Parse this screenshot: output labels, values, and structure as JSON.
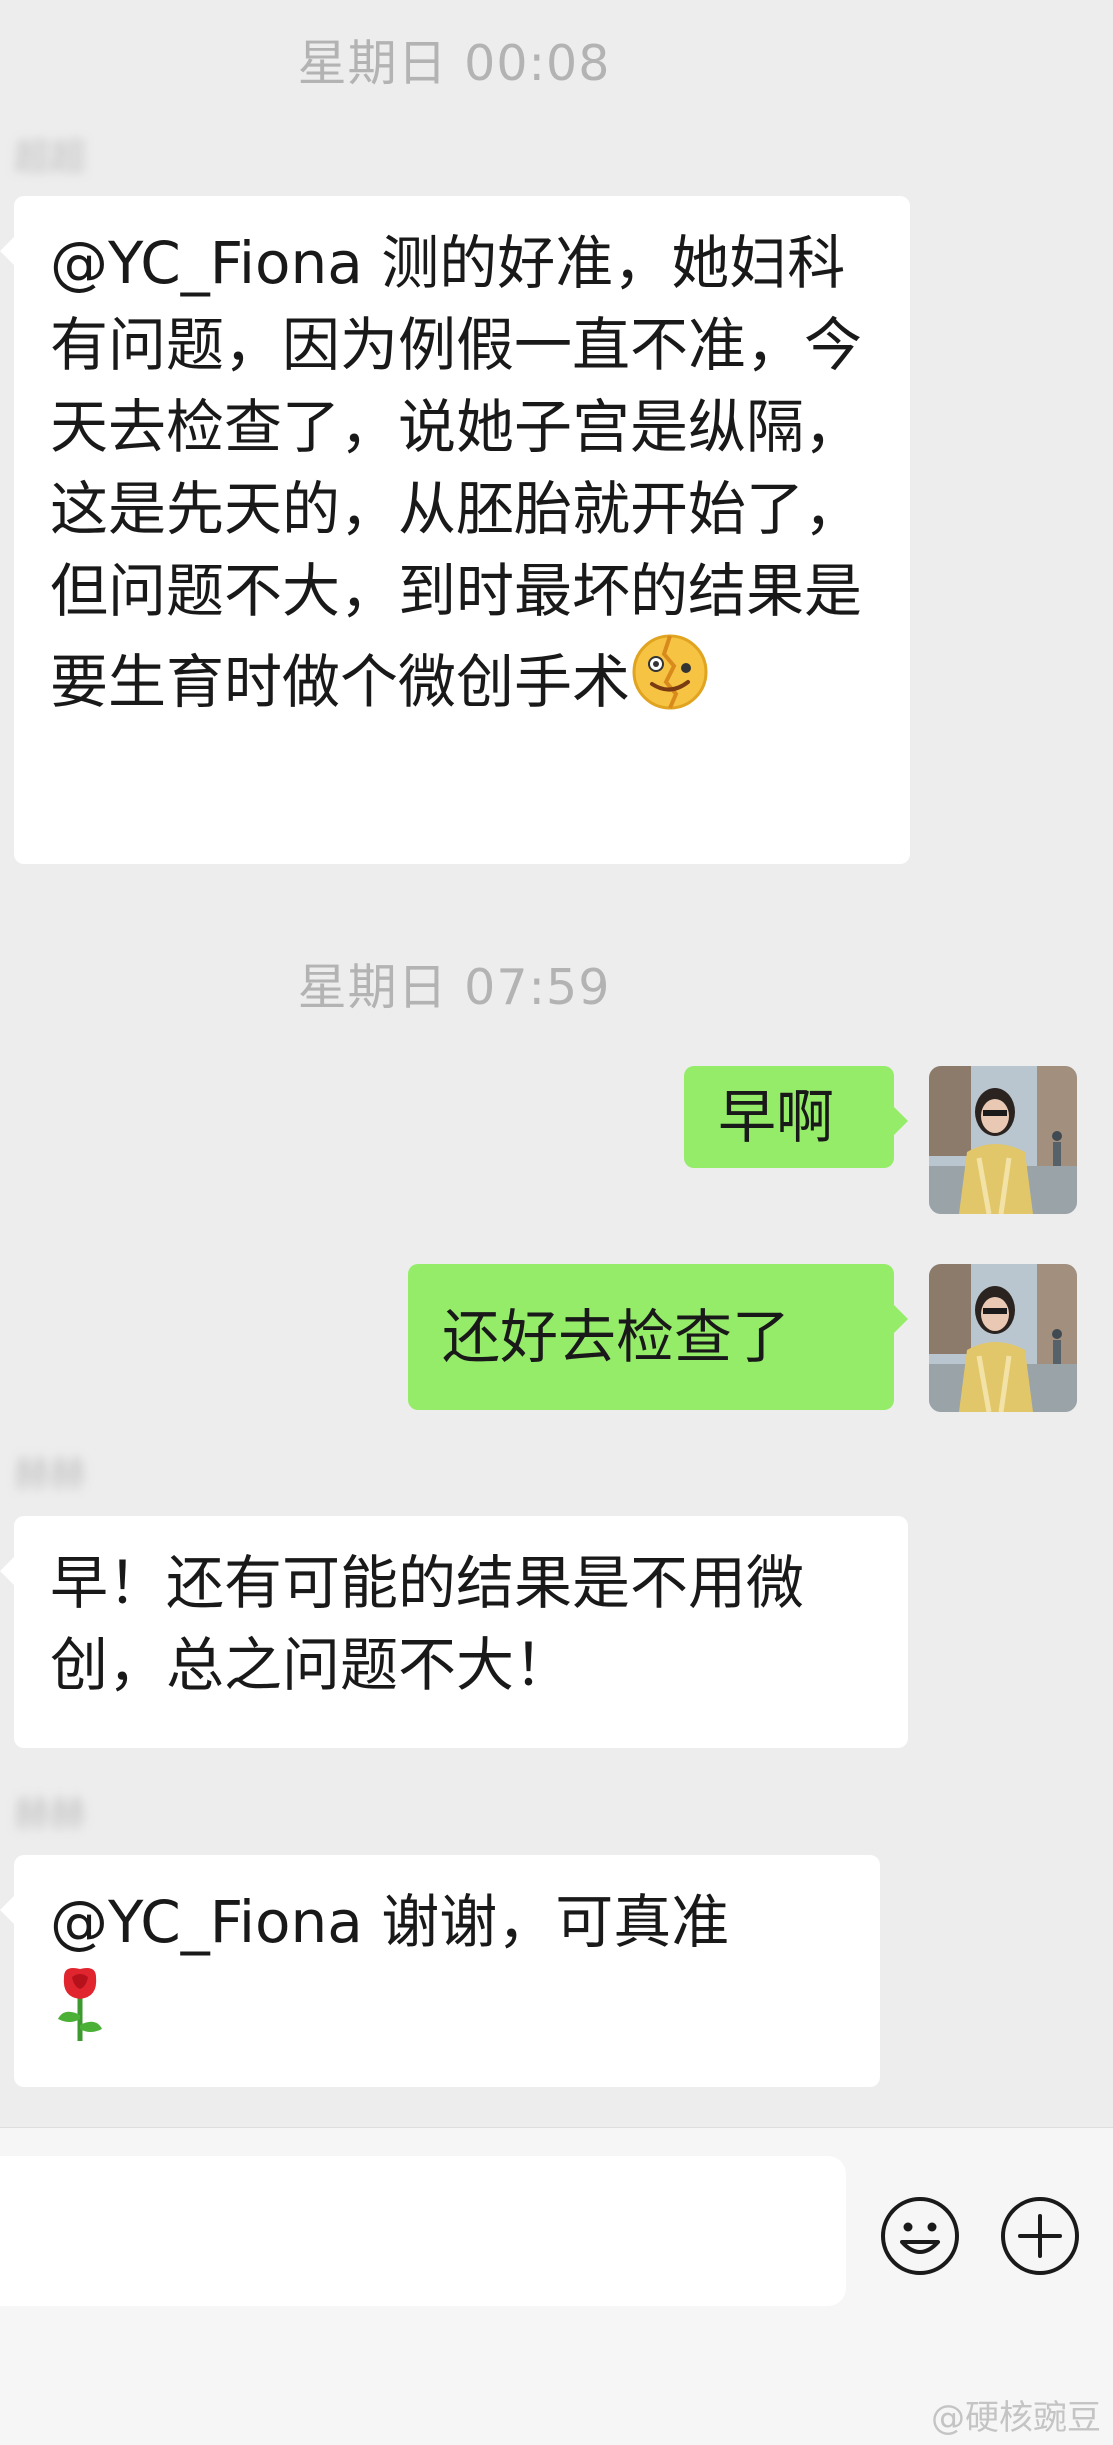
{
  "messages": [
    {
      "type": "timestamp",
      "text": "星期日 00:08"
    },
    {
      "type": "incoming",
      "sender": "超超",
      "text": "@YC_Fiona 测的好准，她妇科有问题，因为例假一直不准，今天去检查了，说她子宫是纵隔，这是先天的，从胚胎就开始了，但问题不大，到时最坏的结果是要生育时做个微创手术",
      "emoji": "zany-face-emoji"
    },
    {
      "type": "timestamp",
      "text": "星期日 07:59"
    },
    {
      "type": "outgoing",
      "text": "早啊"
    },
    {
      "type": "outgoing",
      "text": "还好去检查了"
    },
    {
      "type": "incoming",
      "sender": "赫赫",
      "text": "早！还有可能的结果是不用微创，总之问题不大！"
    },
    {
      "type": "incoming",
      "sender": "赫赫",
      "text": "@YC_Fiona 谢谢，可真准",
      "emoji": "rose-emoji"
    }
  ],
  "input_bar": {
    "emoji_button_icon": "smiley-icon",
    "more_button_icon": "plus-circle-icon"
  },
  "watermark": "@硬核豌豆",
  "colors": {
    "chat_background": "#ededed",
    "outgoing_bubble": "#95ec69",
    "incoming_bubble": "#ffffff",
    "timestamp_text": "#b3b3b3"
  }
}
